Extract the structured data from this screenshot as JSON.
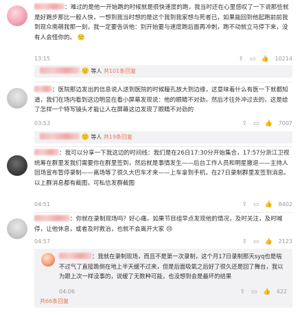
{
  "comments": [
    {
      "text": "难过的是他一开始跑的时候就是很快速度的跑，我当时还在心里感叹了一下说那些就是好跑步那比一般人快，一想到我当时想的是这个我到我家想与死者已，如果能回到他起跑前前我到现众南萌我那一刻，我一定要告诉他：别开始要与速度跑后面再冲刺，跑不动就立马停下来，没有人会怪你的。",
      "emoji": "🙁",
      "time": "13:15",
      "share_icon": "share-icon",
      "like_icon": "thumbs-up-icon",
      "likes": "10214",
      "reply_by": "等人",
      "reply_count": "共101条回复"
    },
    {
      "text": "医院那边发出的信息说人送到医院的时候瞳孔放大到边缘，这意味着什么有医一下就都知道，我们在场内看到这边明显在看小屏幕发现说：他的眼睛不对劲，然后才往外冲过去的，这是给了怎样一个特写镜头才能让人在屏幕这边发现了眼睛不对劲的",
      "time": "03:53",
      "likes": "7007",
      "reply_by": "等人",
      "reply_count": "共19条回复"
    },
    {
      "text": "我可以分享一下我这边的时间线：我们是在26日17:30分开始集合，17:57分浙江卫视统筹在群里发我们需要你在群里签到，然后就是事情发生——后台工作人员和明星撤退——主持人回场宣布暂停录制——离场等了很久大巴车才来——上车拿到手机，在27日录制群里发签到消息。以上群消息都有截图，可私信发群截图",
      "time": "04:51",
      "likes": "8402"
    },
    {
      "text": "你就在录制现场吗？好心痛。如果节目组早点发现他的情况，及时关注，及时喊停，让他休息，或者及时救治，也就不会离开大家",
      "emoji": "😢",
      "time": "04:57",
      "likes": "2123"
    }
  ],
  "reply": {
    "text": "：我就在录制现场，而且不是第一次录制，这个月17日录制那天syq也是喘不过气了直接跪倒在地上半天缓不过来，但是后面吸氧之后好了很久还是回了舞台，我以为跟上次一样没事的，说缓了无数种可能，也没想到会是最坏的结果",
    "time": "04:06",
    "likes": "422",
    "more": "共66条回复"
  }
}
